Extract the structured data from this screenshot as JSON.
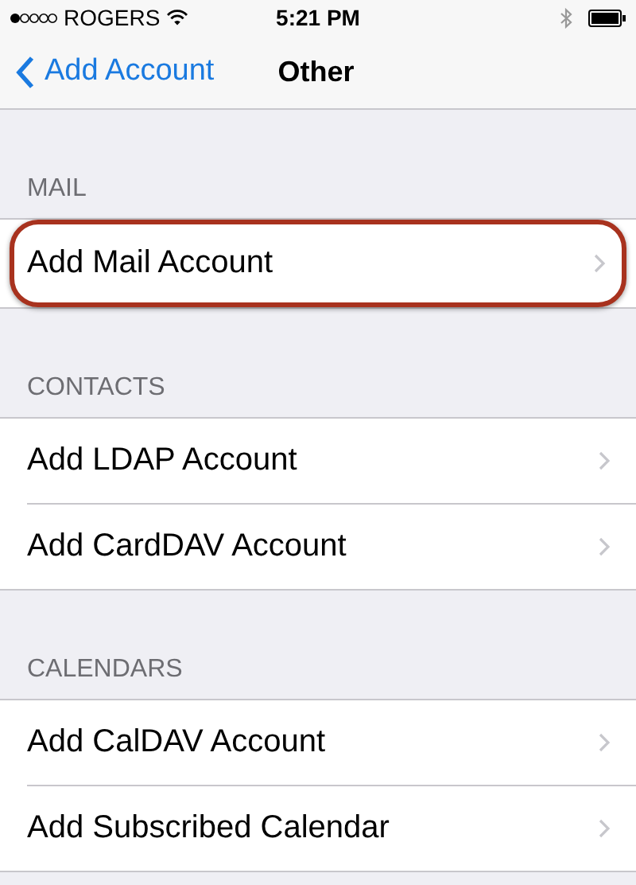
{
  "status_bar": {
    "carrier": "ROGERS",
    "time": "5:21 PM"
  },
  "nav": {
    "back": "Add Account",
    "title": "Other"
  },
  "sections": [
    {
      "header": "MAIL",
      "rows": [
        {
          "label": "Add Mail Account",
          "highlighted": true
        }
      ]
    },
    {
      "header": "CONTACTS",
      "rows": [
        {
          "label": "Add LDAP Account",
          "highlighted": false
        },
        {
          "label": "Add CardDAV Account",
          "highlighted": false
        }
      ]
    },
    {
      "header": "CALENDARS",
      "rows": [
        {
          "label": "Add CalDAV Account",
          "highlighted": false
        },
        {
          "label": "Add Subscribed Calendar",
          "highlighted": false
        }
      ]
    }
  ]
}
